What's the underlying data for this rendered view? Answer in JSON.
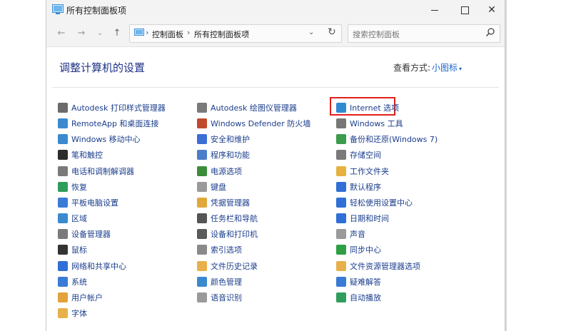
{
  "window": {
    "title": "所有控制面板项"
  },
  "address": {
    "crumbs": [
      "控制面板",
      "所有控制面板项"
    ]
  },
  "search": {
    "placeholder": "搜索控制面板"
  },
  "header": {
    "title": "调整计算机的设置",
    "view_by_label": "查看方式:",
    "view_by_value": "小图标"
  },
  "colors": {
    "link": "#1a3d8c",
    "title": "#1e3287",
    "highlight": "#e0201c"
  },
  "columns": [
    {
      "items": [
        {
          "label": "Autodesk 打印样式管理器",
          "icon": "printer-icon"
        },
        {
          "label": "RemoteApp 和桌面连接",
          "icon": "remoteapp-icon"
        },
        {
          "label": "Windows 移动中心",
          "icon": "mobility-icon"
        },
        {
          "label": "笔和触控",
          "icon": "pen-icon"
        },
        {
          "label": "电话和调制解调器",
          "icon": "phone-icon"
        },
        {
          "label": "恢复",
          "icon": "recovery-icon"
        },
        {
          "label": "平板电脑设置",
          "icon": "tablet-icon"
        },
        {
          "label": "区域",
          "icon": "globe-icon"
        },
        {
          "label": "设备管理器",
          "icon": "device-manager-icon"
        },
        {
          "label": "鼠标",
          "icon": "mouse-icon"
        },
        {
          "label": "网络和共享中心",
          "icon": "network-icon"
        },
        {
          "label": "系统",
          "icon": "system-icon"
        },
        {
          "label": "用户帐户",
          "icon": "users-icon"
        },
        {
          "label": "字体",
          "icon": "fonts-icon"
        }
      ]
    },
    {
      "items": [
        {
          "label": "Autodesk 绘图仪管理器",
          "icon": "plotter-icon"
        },
        {
          "label": "Windows Defender 防火墙",
          "icon": "firewall-icon"
        },
        {
          "label": "安全和维护",
          "icon": "flag-icon"
        },
        {
          "label": "程序和功能",
          "icon": "programs-icon"
        },
        {
          "label": "电源选项",
          "icon": "power-icon"
        },
        {
          "label": "键盘",
          "icon": "keyboard-icon"
        },
        {
          "label": "凭据管理器",
          "icon": "credentials-icon"
        },
        {
          "label": "任务栏和导航",
          "icon": "taskbar-icon"
        },
        {
          "label": "设备和打印机",
          "icon": "devices-printers-icon"
        },
        {
          "label": "索引选项",
          "icon": "indexing-icon"
        },
        {
          "label": "文件历史记录",
          "icon": "file-history-icon"
        },
        {
          "label": "颜色管理",
          "icon": "color-icon"
        },
        {
          "label": "语音识别",
          "icon": "microphone-icon"
        }
      ]
    },
    {
      "items": [
        {
          "label": "Internet 选项",
          "icon": "internet-icon"
        },
        {
          "label": "Windows 工具",
          "icon": "tools-icon"
        },
        {
          "label": "备份和还原(Windows 7)",
          "icon": "backup-icon"
        },
        {
          "label": "存储空间",
          "icon": "storage-icon"
        },
        {
          "label": "工作文件夹",
          "icon": "work-folders-icon"
        },
        {
          "label": "默认程序",
          "icon": "default-programs-icon"
        },
        {
          "label": "轻松使用设置中心",
          "icon": "ease-of-access-icon"
        },
        {
          "label": "日期和时间",
          "icon": "clock-icon"
        },
        {
          "label": "声音",
          "icon": "speaker-icon"
        },
        {
          "label": "同步中心",
          "icon": "sync-icon"
        },
        {
          "label": "文件资源管理器选项",
          "icon": "folder-options-icon"
        },
        {
          "label": "疑难解答",
          "icon": "troubleshoot-icon"
        },
        {
          "label": "自动播放",
          "icon": "autoplay-icon"
        }
      ]
    }
  ]
}
